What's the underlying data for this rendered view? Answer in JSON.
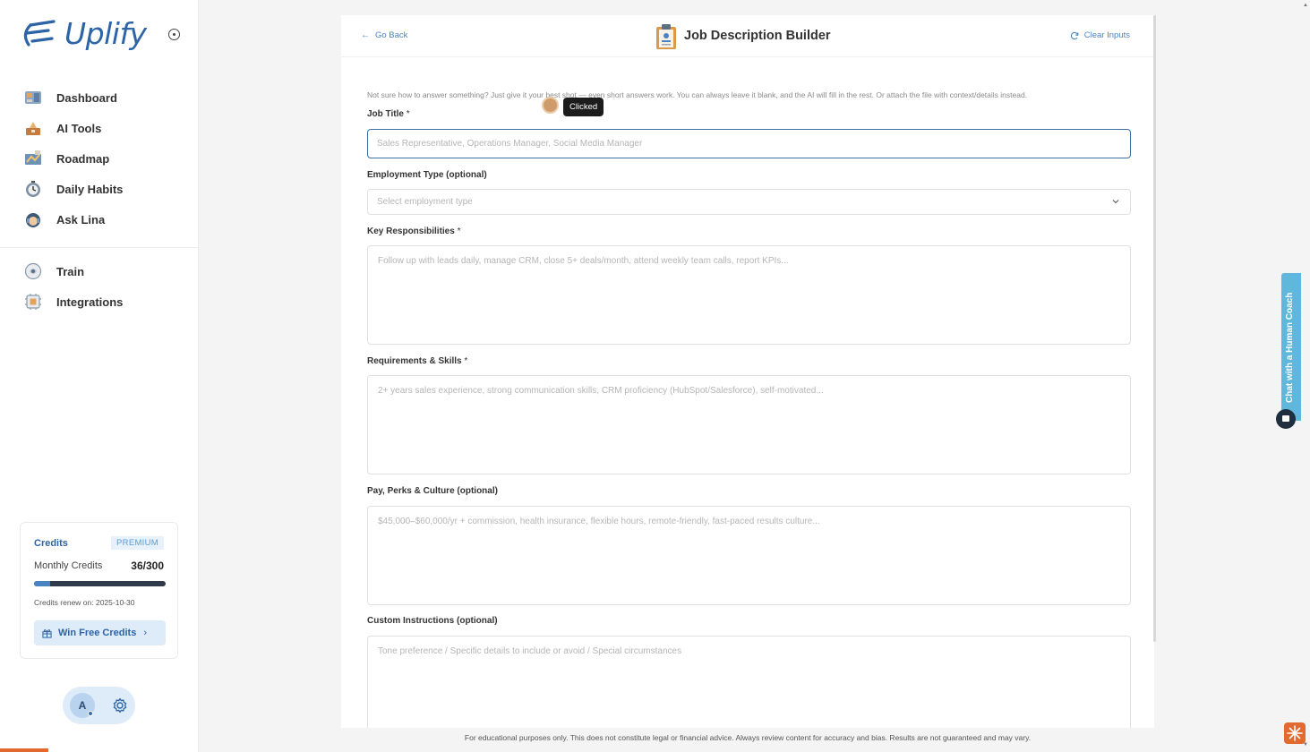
{
  "brand": {
    "name": "Uplify"
  },
  "sidebar": {
    "main_items": [
      {
        "label": "Dashboard",
        "icon": "dashboard-icon"
      },
      {
        "label": "AI Tools",
        "icon": "ai-tools-icon"
      },
      {
        "label": "Roadmap",
        "icon": "roadmap-icon"
      },
      {
        "label": "Daily Habits",
        "icon": "daily-habits-icon"
      },
      {
        "label": "Ask Lina",
        "icon": "ask-lina-icon"
      }
    ],
    "secondary_items": [
      {
        "label": "Train",
        "icon": "train-icon"
      },
      {
        "label": "Integrations",
        "icon": "integrations-icon"
      }
    ]
  },
  "credits": {
    "title": "Credits",
    "badge": "PREMIUM",
    "monthly_label": "Monthly Credits",
    "monthly_value": "36/300",
    "used_fraction": 0.12,
    "renew_text": "Credits renew on: 2025-10-30",
    "win_button": "Win Free Credits"
  },
  "user": {
    "initial": "A"
  },
  "header": {
    "back_label": "Go Back",
    "title": "Job Description Builder",
    "clear_label": "Clear Inputs"
  },
  "form": {
    "hint": "Not sure how to answer something? Just give it your best shot — even short answers work. You can always leave it blank, and the AI will fill in the rest. Or attach the file with context/details instead.",
    "job_title": {
      "label": "Job Title",
      "required": "*",
      "value": "",
      "placeholder": "Sales Representative, Operations Manager, Social Media Manager"
    },
    "employment_type": {
      "label": "Employment Type (optional)",
      "placeholder": "Select employment type"
    },
    "responsibilities": {
      "label": "Key Responsibilities",
      "required": "*",
      "value": "",
      "placeholder": "Follow up with leads daily, manage CRM, close 5+ deals/month, attend weekly team calls, report KPIs..."
    },
    "requirements": {
      "label": "Requirements & Skills",
      "required": "*",
      "value": "",
      "placeholder": "2+ years sales experience, strong communication skills, CRM proficiency (HubSpot/Salesforce), self-motivated..."
    },
    "pay": {
      "label": "Pay, Perks & Culture (optional)",
      "value": "",
      "placeholder": "$45,000–$60,000/yr + commission, health insurance, flexible hours, remote-friendly, fast-paced results culture..."
    },
    "custom": {
      "label": "Custom Instructions (optional)",
      "value": "",
      "placeholder": "Tone preference / Specific details to include or avoid / Special circumstances"
    }
  },
  "tooltip": {
    "text": "Clicked"
  },
  "coach_tab": {
    "label": "Chat with a Human Coach"
  },
  "footer": {
    "disclaimer": "For educational purposes only. This does not constitute legal or financial advice. Always review content for accuracy and bias. Results are not guaranteed and may vary."
  },
  "colors": {
    "brand_blue": "#2c64a6",
    "accent_orange": "#e36a2f",
    "coach_tab": "#5fb7dc"
  }
}
